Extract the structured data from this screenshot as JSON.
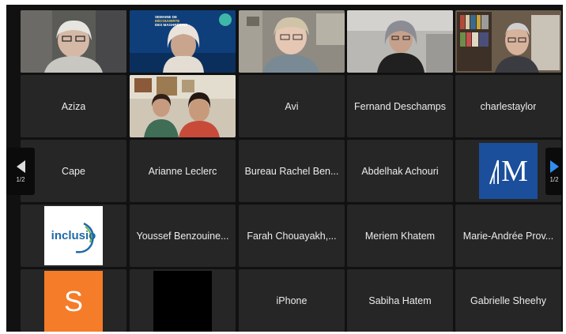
{
  "colors": {
    "background": "#111111",
    "tile": "#262626",
    "active_speaker": "#3ec24a",
    "next_arrow": "#2f8ff0",
    "avatar_orange": "#f57c28",
    "avatar_m_blue": "#1b4e9b",
    "inclusio_green": "#6db33f",
    "inclusio_blue": "#1f6aa5"
  },
  "participants": [
    "Aziza",
    "Avi",
    "Fernand Deschamps",
    "charlestaylor",
    "Cape",
    "Arianne Leclerc",
    "Bureau Rachel Ben...",
    "Abdelhak Achouri",
    "Youssef Benzouine...",
    "Farah Chouayakh,...",
    "Meriem Khatem",
    "Marie-Andrée Prov...",
    "iPhone",
    "Sabiha Hatem",
    "Gabrielle Sheehy"
  ],
  "banner": {
    "line1": "SEMAINE DE",
    "line2": "DÉCOUVERTE",
    "line3": "DES MAGHRÉBINS"
  },
  "avatars": {
    "inclusio": "inclusio",
    "s_letter": "S",
    "m_letter": "M"
  },
  "nav": {
    "prev_page": "1/2",
    "next_page": "1/2"
  }
}
